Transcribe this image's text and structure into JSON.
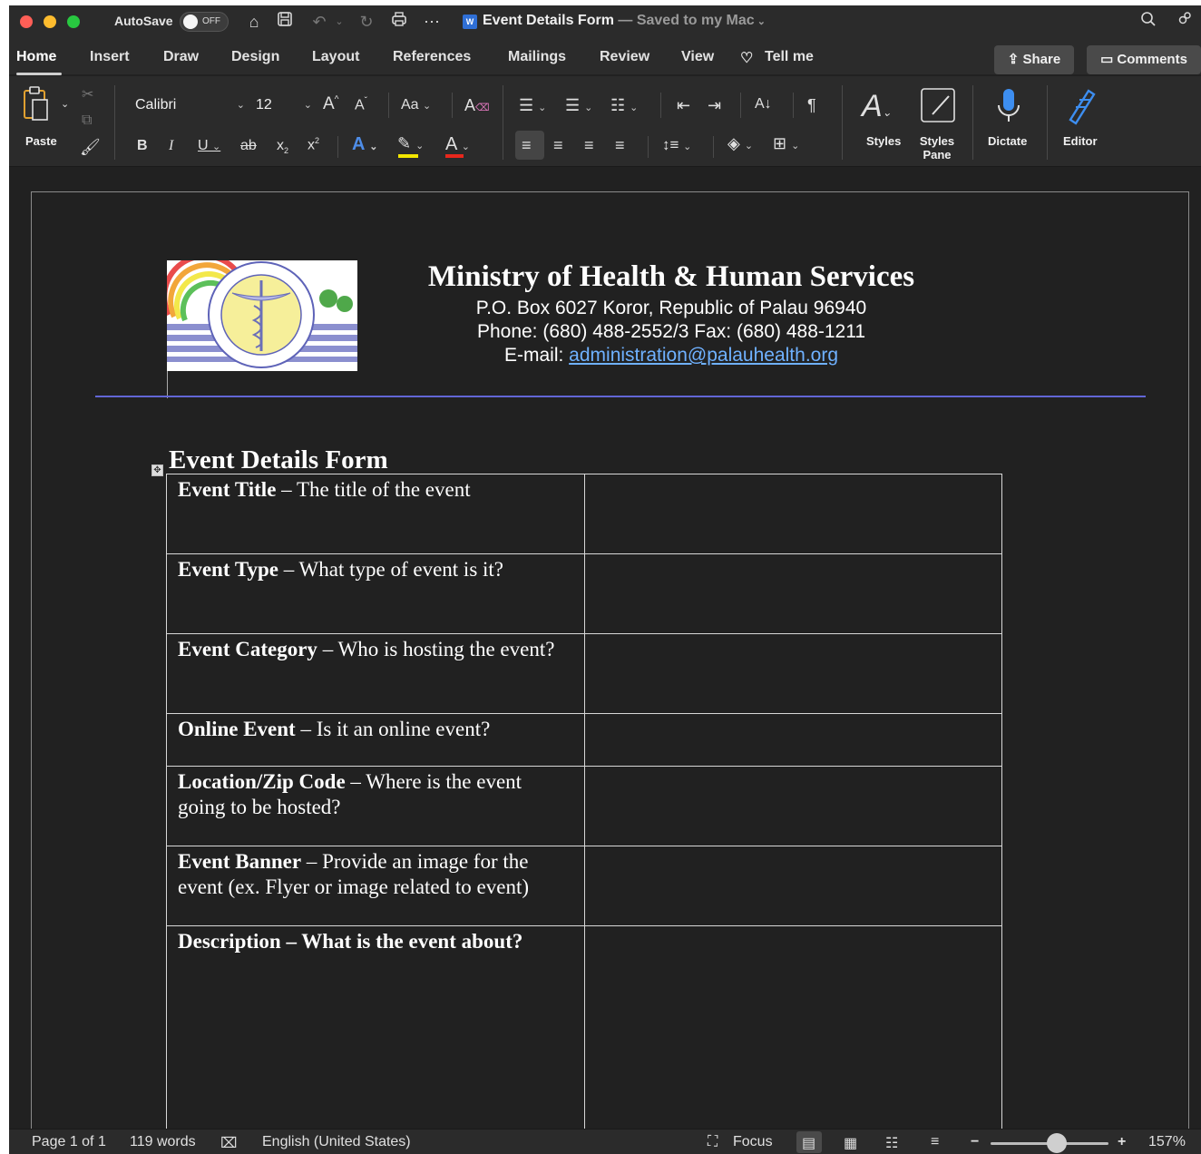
{
  "titlebar": {
    "autosave_label": "AutoSave",
    "autosave_state": "OFF",
    "doc_name": "Event Details Form",
    "doc_status": " — Saved to my Mac",
    "word_badge": "W"
  },
  "tabs": [
    "Home",
    "Insert",
    "Draw",
    "Design",
    "Layout",
    "References",
    "Mailings",
    "Review",
    "View",
    "Tell me"
  ],
  "share_label": "Share",
  "comments_label": "Comments",
  "ribbon": {
    "paste_label": "Paste",
    "font_name": "Calibri",
    "font_size": "12",
    "styles_label": "Styles",
    "styles_pane_label": "Styles Pane",
    "dictate_label": "Dictate",
    "editor_label": "Editor",
    "highlight_color": "#f2e600",
    "font_color": "#e8271c"
  },
  "document": {
    "org_name": "Ministry of Health & Human Services",
    "address": "P.O. Box 6027 Koror, Republic of Palau 96940",
    "phone": "Phone:  (680) 488-2552/3  Fax:  (680) 488-1211",
    "email_prefix": "E-mail: ",
    "email": "administration@palauhealth.org",
    "form_title": "Event Details Form",
    "rows": [
      {
        "label": "Event Title",
        "prompt": " – The title of the event",
        "height": "single"
      },
      {
        "label": "Event Type",
        "prompt": " – What type of event is it?",
        "height": "single"
      },
      {
        "label": "Event Category",
        "prompt": " – Who is hosting the event?",
        "height": "single"
      },
      {
        "label": "Online Event",
        "prompt": " – Is it an online event?",
        "height": "short"
      },
      {
        "label": "Location/Zip Code",
        "prompt": " – Where is the event going to be hosted?",
        "height": "single"
      },
      {
        "label": "Event Banner",
        "prompt": " – Provide an image for the event (ex. Flyer or image related to event)",
        "height": "single"
      },
      {
        "label": "Description – What is the event about?",
        "prompt": "",
        "height": "tall"
      }
    ]
  },
  "statusbar": {
    "page": "Page 1 of 1",
    "words": "119 words",
    "language": "English (United States)",
    "focus": "Focus",
    "zoom": "157%"
  }
}
